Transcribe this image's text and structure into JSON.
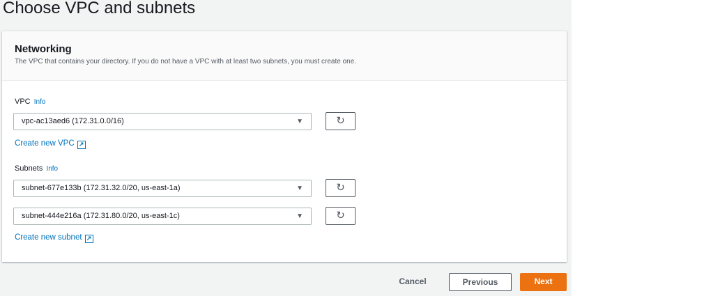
{
  "page": {
    "title": "Choose VPC and subnets"
  },
  "networking": {
    "title": "Networking",
    "description": "The VPC that contains your directory. If you do not have a VPC with at least two subnets, you must create one.",
    "vpc_label": "VPC",
    "info": "Info",
    "vpc_value": "vpc-ac13aed6 (172.31.0.0/16)",
    "create_vpc": "Create new VPC",
    "subnets_label": "Subnets",
    "subnet1": "subnet-677e133b (172.31.32.0/20, us-east-1a)",
    "subnet2": "subnet-444e216a (172.31.80.0/20, us-east-1c)",
    "create_subnet": "Create new subnet"
  },
  "footer": {
    "cancel": "Cancel",
    "previous": "Previous",
    "next": "Next"
  },
  "colors": {
    "accent": "#ec7211",
    "link": "#0073bb"
  }
}
